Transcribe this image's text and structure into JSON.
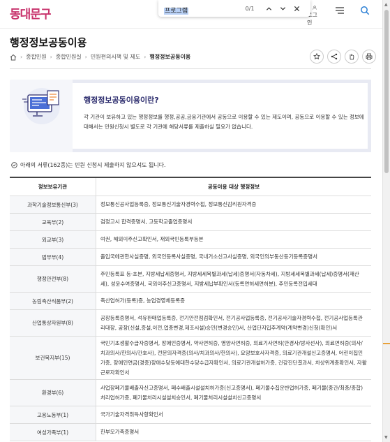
{
  "header": {
    "logo": "동대문구",
    "login_label": "로그인"
  },
  "findbar": {
    "query": "프로그램",
    "count": "0/1"
  },
  "page": {
    "title": "행정정보공동이용"
  },
  "breadcrumb": [
    "종합민원",
    "종합민원실",
    "민원편의시책 및 제도",
    "행정정보공동이용"
  ],
  "info": {
    "title": "행정정보공동이용이란?",
    "text": "각 기관이 보유하고 있는 행정정보를 행정,공공,금융기관에서 공동으로 이용할 수 있는 제도이며, 공동으로 이용할 수 있는 정보에 대해서는 민원신청시 별도로 각 기관에 해당서류를 제출하실 필요가 없습니다."
  },
  "notice": "아래의 서류(162종)는 민원 신청시 제출하지 않으셔도 됩니다.",
  "table": {
    "headers": [
      "정보보유기관",
      "공동이용 대상 행정정보"
    ],
    "rows": [
      {
        "org": "과학기술정보통신부(3)",
        "docs": "정보통신공사업등록증, 정보통신기술자경력수첩, 정보통신감리원자격증"
      },
      {
        "org": "교육부(2)",
        "docs": "검정고시 합격증명서, 고등학교졸업증명서"
      },
      {
        "org": "외교부(3)",
        "docs": "여권, 해외이주신고확인서, 재외국민등록부등본"
      },
      {
        "org": "법무부(4)",
        "docs": "출입국에관한사실증명, 외국인등록사실증명, 국내거소신고사실증명, 외국인의부동산등기등록증명서"
      },
      {
        "org": "행정안전부(8)",
        "docs": "주민등록표 등·초본, 지방세납세증명서, 지방세세목별과세(납세)증명서(자동차세), 지방세세목별과세(납세)증명서(재산세), 성윤수여증명서, 국외이주신고증명서, 지방세납부확인서(등록면허세면허분), 주민등록전입세대"
      },
      {
        "org": "농림축산식품부(2)",
        "docs": "축산업허가(등록)증, 농업경영체등록증"
      },
      {
        "org": "산업통상자원부(8)",
        "docs": "공장등록증명서, 석유판매업등록증, 전기안전점검확인서, 전기공사업등록증, 전기공사기술자경력수첩, 전기공사업등록관리대장, 공장(신설,증설,이전,업종변경,제조시설)승인(변경승인)서, 산업단지입주계약(계약변경)신청(확인)서"
      },
      {
        "org": "보건복지부(15)",
        "docs": "국민기초생활수급자증명서, 장애인증명서, 약사면허증, 영양사면허증, 의료기사면허(안경사/방사선사), 의료면허증(의사/치과의사/한의사/간호사), 전문의자격증(의사/치과의사/한의사), 요양보호사자격증, 의료기관개설신고증명서, 어린이집인가증, 장애인연금(경증)장애수당등에대한수당수급자확인서, 의료기관개설허가증, 건강진단결과서, 차상위계층확인서, 자활근로자확인서"
      },
      {
        "org": "환경부(6)",
        "docs": "사업장폐기물배출자신고증명서, 폐수배출시설설치허가증(신고증명서), 폐기물수집운반업허가증, 폐기물(중간/최종/종합)처리업허가증, 폐기물처리시설설치승인서, 폐기물처리시설설치신고증명서"
      },
      {
        "org": "고용노동부(1)",
        "docs": "국가기술자격취득사항확인서"
      },
      {
        "org": "여성가족부(1)",
        "docs": "한부모가족증명서"
      }
    ]
  },
  "colors": {
    "brand": "#c8336c",
    "info_title": "#2a2a6c",
    "scroll_mark": "#e8a13a"
  }
}
